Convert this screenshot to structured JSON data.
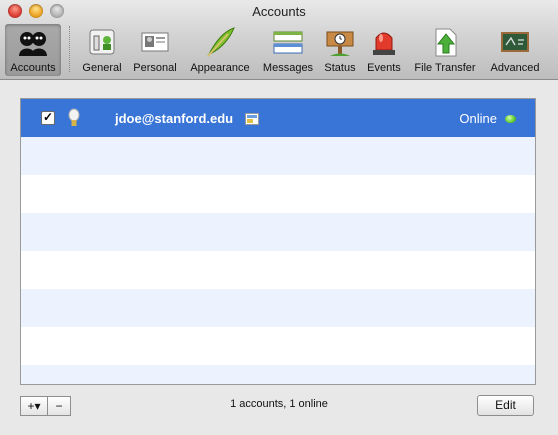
{
  "window": {
    "title": "Accounts"
  },
  "toolbar": {
    "items": [
      {
        "label": "Accounts",
        "icon": "accounts-icon"
      },
      {
        "label": "General",
        "icon": "general-icon"
      },
      {
        "label": "Personal",
        "icon": "personal-icon"
      },
      {
        "label": "Appearance",
        "icon": "appearance-feather-icon"
      },
      {
        "label": "Messages",
        "icon": "messages-icon"
      },
      {
        "label": "Status",
        "icon": "status-sign-icon"
      },
      {
        "label": "Events",
        "icon": "events-siren-icon"
      },
      {
        "label": "File Transfer",
        "icon": "file-transfer-icon"
      },
      {
        "label": "Advanced",
        "icon": "advanced-chalkboard-icon"
      }
    ],
    "selected": "Accounts"
  },
  "accounts": {
    "rows": [
      {
        "enabled": true,
        "checkmark": "✓",
        "name": "jdoe@stanford.edu",
        "status": "Online",
        "status_color": "#5ccf2e"
      }
    ],
    "selection_color": "#3875d7",
    "alt_row_color": "#edf3fe"
  },
  "footer": {
    "add_label": "+▾",
    "remove_label": "−",
    "summary": "1 accounts, 1 online",
    "edit_label": "Edit"
  }
}
